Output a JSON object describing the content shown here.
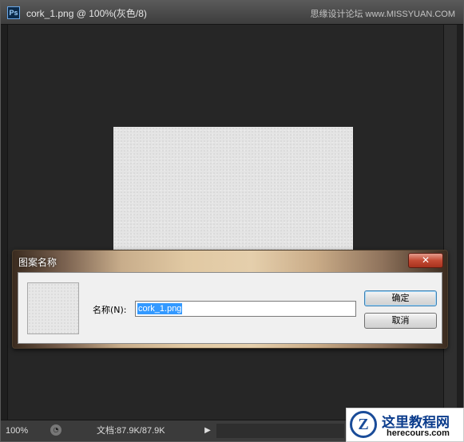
{
  "window": {
    "app_icon": "Ps",
    "title": "cork_1.png @ 100%(灰色/8)",
    "watermark": "思缘设计论坛 www.MISSYUAN.COM"
  },
  "status": {
    "zoom": "100%",
    "doc_info": "文档:87.9K/87.9K",
    "arrow": "▶"
  },
  "dialog": {
    "title": "图案名称",
    "close_glyph": "✕",
    "name_label": "名称(N):",
    "name_value": "cork_1.png",
    "ok_label": "确定",
    "cancel_label": "取消"
  },
  "site": {
    "logo_letter": "Z",
    "name": "这里教程网",
    "url": "herecours.com"
  },
  "colors": {
    "dialog_accent": "#d8bc94",
    "selection": "#3399ff",
    "close_button": "#c44b34"
  }
}
